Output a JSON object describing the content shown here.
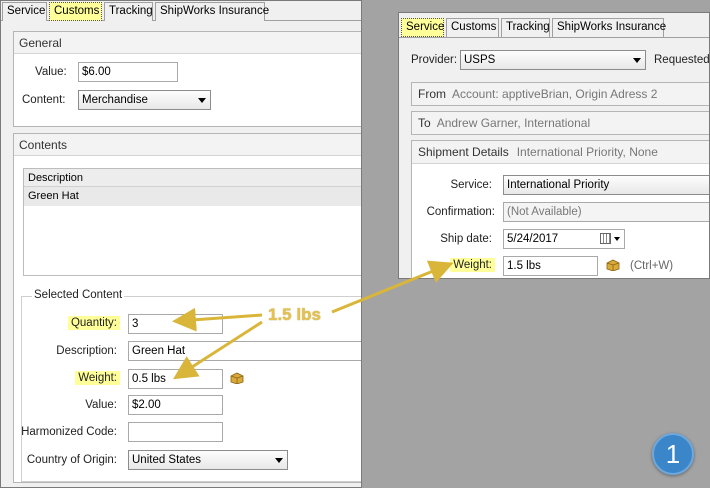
{
  "left_window": {
    "tabs": [
      "Service",
      "Customs",
      "Tracking",
      "ShipWorks Insurance"
    ],
    "active_tab": "Customs",
    "general": {
      "header": "General",
      "value_label": "Value:",
      "value": "$6.00",
      "content_label": "Content:",
      "content_value": "Merchandise"
    },
    "contents": {
      "header": "Contents",
      "column_header": "Description",
      "rows": [
        "Green Hat"
      ],
      "selected_header": "Selected Content",
      "quantity_label": "Quantity:",
      "quantity": "3",
      "description_label": "Description:",
      "description": "Green Hat",
      "weight_label": "Weight:",
      "weight": "0.5 lbs",
      "value_label": "Value:",
      "value": "$2.00",
      "harmonized_label": "Harmonized Code:",
      "harmonized": "",
      "country_label": "Country of Origin:",
      "country": "United States"
    }
  },
  "right_window": {
    "tabs": [
      "Service",
      "Customs",
      "Tracking",
      "ShipWorks Insurance"
    ],
    "active_tab": "Service",
    "provider_label": "Provider:",
    "provider": "USPS",
    "requested_label": "Requested",
    "from_label": "From",
    "from_value": "Account: apptiveBrian, Origin Adress 2",
    "to_label": "To",
    "to_value": "Andrew Garner, International",
    "shipment_label": "Shipment Details",
    "shipment_value": "International Priority, None",
    "service_label": "Service:",
    "service": "International Priority",
    "confirmation_label": "Confirmation:",
    "confirmation": "(Not Available)",
    "shipdate_label": "Ship date:",
    "shipdate": "5/24/2017",
    "weight_label": "Weight:",
    "weight": "1.5 lbs",
    "weight_hint": "(Ctrl+W)"
  },
  "annotation": {
    "callout": "1.5 lbs",
    "badge": "1",
    "arrow_color": "#d9b63a"
  },
  "colors": {
    "highlight": "#ffff99",
    "badge": "#3a86c8",
    "background": "#a3a3a3"
  }
}
